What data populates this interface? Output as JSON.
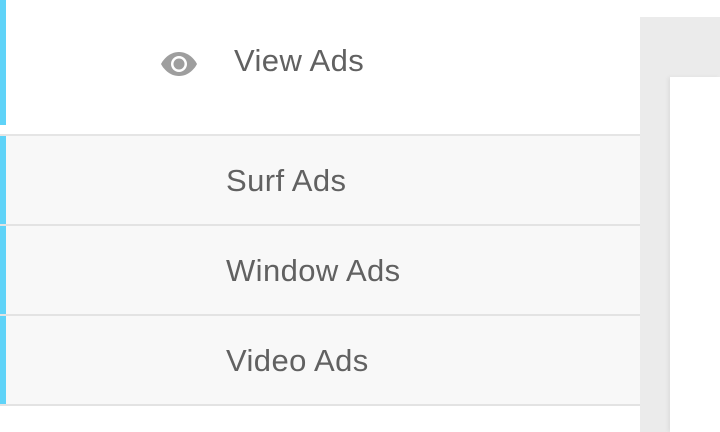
{
  "menu": {
    "parent": {
      "label": "View Ads",
      "icon": "eye-icon"
    },
    "items": [
      {
        "label": "Surf Ads"
      },
      {
        "label": "Window Ads"
      },
      {
        "label": "Video Ads"
      }
    ]
  },
  "colors": {
    "accent": "#5fd3f8",
    "text": "#616161",
    "submenu_bg": "#f8f8f8",
    "content_bg": "#ebebeb"
  }
}
